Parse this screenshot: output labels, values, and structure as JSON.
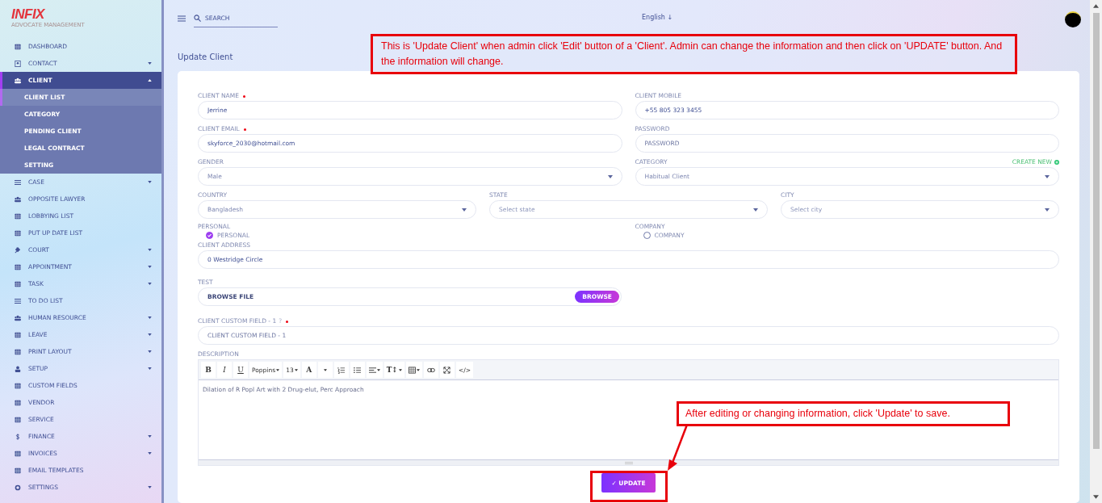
{
  "brand": {
    "logo": "INFIX",
    "tagline": "ADVOCATE MANAGEMENT"
  },
  "sidebar": {
    "items": [
      {
        "label": "DASHBOARD",
        "kind": "link",
        "selected": false
      },
      {
        "label": "CONTACT",
        "kind": "group",
        "expanded": false,
        "selected": false
      },
      {
        "label": "CLIENT",
        "kind": "group",
        "expanded": true,
        "selected": true,
        "children": [
          {
            "label": "CLIENT LIST",
            "selected": true
          },
          {
            "label": "CATEGORY",
            "selected": false
          },
          {
            "label": "PENDING CLIENT",
            "selected": false
          },
          {
            "label": "LEGAL CONTRACT",
            "selected": false
          },
          {
            "label": "SETTING",
            "selected": false
          }
        ]
      },
      {
        "label": "CASE",
        "kind": "group",
        "expanded": false,
        "selected": false
      },
      {
        "label": "OPPOSITE LAWYER",
        "kind": "link",
        "selected": false
      },
      {
        "label": "LOBBYING LIST",
        "kind": "link",
        "selected": false
      },
      {
        "label": "PUT UP DATE LIST",
        "kind": "link",
        "selected": false
      },
      {
        "label": "COURT",
        "kind": "group",
        "expanded": false,
        "selected": false
      },
      {
        "label": "APPOINTMENT",
        "kind": "group",
        "expanded": false,
        "selected": false
      },
      {
        "label": "TASK",
        "kind": "group",
        "expanded": false,
        "selected": false
      },
      {
        "label": "TO DO LIST",
        "kind": "link",
        "selected": false
      },
      {
        "label": "HUMAN RESOURCE",
        "kind": "group",
        "expanded": false,
        "selected": false
      },
      {
        "label": "LEAVE",
        "kind": "group",
        "expanded": false,
        "selected": false
      },
      {
        "label": "PRINT LAYOUT",
        "kind": "group",
        "expanded": false,
        "selected": false
      },
      {
        "label": "SETUP",
        "kind": "group",
        "expanded": false,
        "selected": false
      },
      {
        "label": "CUSTOM FIELDS",
        "kind": "link",
        "selected": false
      },
      {
        "label": "VENDOR",
        "kind": "link",
        "selected": false
      },
      {
        "label": "SERVICE",
        "kind": "link",
        "selected": false
      },
      {
        "label": "FINANCE",
        "kind": "group",
        "expanded": false,
        "selected": false
      },
      {
        "label": "INVOICES",
        "kind": "group",
        "expanded": false,
        "selected": false
      },
      {
        "label": "EMAIL TEMPLATES",
        "kind": "link",
        "selected": false
      },
      {
        "label": "SETTINGS",
        "kind": "group",
        "expanded": false,
        "selected": false
      }
    ]
  },
  "topbar": {
    "search": {
      "placeholder": "SEARCH"
    },
    "language": "English",
    "language_arrow": "↓"
  },
  "page_title": "Update Client",
  "form": {
    "client_name": {
      "label": "CLIENT NAME",
      "required": true,
      "value": "Jerrine"
    },
    "client_mobile": {
      "label": "CLIENT MOBILE",
      "required": false,
      "value": "+55 805 323 3455"
    },
    "client_email": {
      "label": "CLIENT EMAIL",
      "required": true,
      "value": "skyforce_2030@hotmail.com"
    },
    "password": {
      "label": "PASSWORD",
      "required": false,
      "placeholder": "PASSWORD"
    },
    "gender": {
      "label": "GENDER",
      "value": "Male"
    },
    "category": {
      "label": "CATEGORY",
      "value": "Habitual Client",
      "create_new": "CREATE NEW"
    },
    "country": {
      "label": "COUNTRY",
      "value": "Bangladesh"
    },
    "state": {
      "label": "STATE",
      "placeholder": "Select state"
    },
    "city": {
      "label": "CITY",
      "placeholder": "Select city"
    },
    "client_types": [
      {
        "group_label": "PERSONAL",
        "label": "PERSONAL",
        "selected": true
      },
      {
        "group_label": "COMPANY",
        "label": "COMPANY",
        "selected": false
      }
    ],
    "client_address": {
      "label": "CLIENT ADDRESS",
      "value": "0 Westridge Circle"
    },
    "test": {
      "label": "TEST",
      "file_text": "BROWSE FILE",
      "button": "BROWSE"
    },
    "custom_field": {
      "label": "CLIENT CUSTOM FIELD - 1",
      "help": "?",
      "required": true,
      "placeholder": "CLIENT CUSTOM FIELD - 1"
    },
    "description": {
      "label": "DESCRIPTION",
      "text": "Dilation of R Popl Art with 2 Drug-elut, Perc Approach",
      "toolbar": [
        {
          "kind": "bold",
          "label": "B",
          "dropdown": false
        },
        {
          "kind": "italic",
          "label": "I",
          "dropdown": false
        },
        {
          "kind": "underline",
          "label": "U",
          "dropdown": false
        },
        {
          "kind": "text",
          "label": "Poppins",
          "dropdown": true
        },
        {
          "kind": "text",
          "label": "13",
          "dropdown": true
        },
        {
          "kind": "bold",
          "label": "A",
          "dropdown": false
        },
        {
          "kind": "caret",
          "dropdown": true
        },
        {
          "kind": "olist",
          "dropdown": false
        },
        {
          "kind": "ulist",
          "dropdown": false
        },
        {
          "kind": "align",
          "dropdown": true
        },
        {
          "kind": "bold",
          "label": "T↕",
          "dropdown": true
        },
        {
          "kind": "table",
          "dropdown": true
        },
        {
          "kind": "link",
          "dropdown": false
        },
        {
          "kind": "expand",
          "dropdown": false
        },
        {
          "kind": "text",
          "label": "</>",
          "dropdown": false
        }
      ]
    },
    "submit": {
      "check": "✓",
      "label": "UPDATE"
    }
  },
  "annotations": [
    {
      "kind": "box",
      "text": "This is 'Update Client' when admin click 'Edit' button of a 'Client'. Admin can change the information and then click on 'UPDATE' button. And the information will change."
    },
    {
      "kind": "arrow",
      "text": "After editing or changing information, click 'Update' to save."
    }
  ]
}
